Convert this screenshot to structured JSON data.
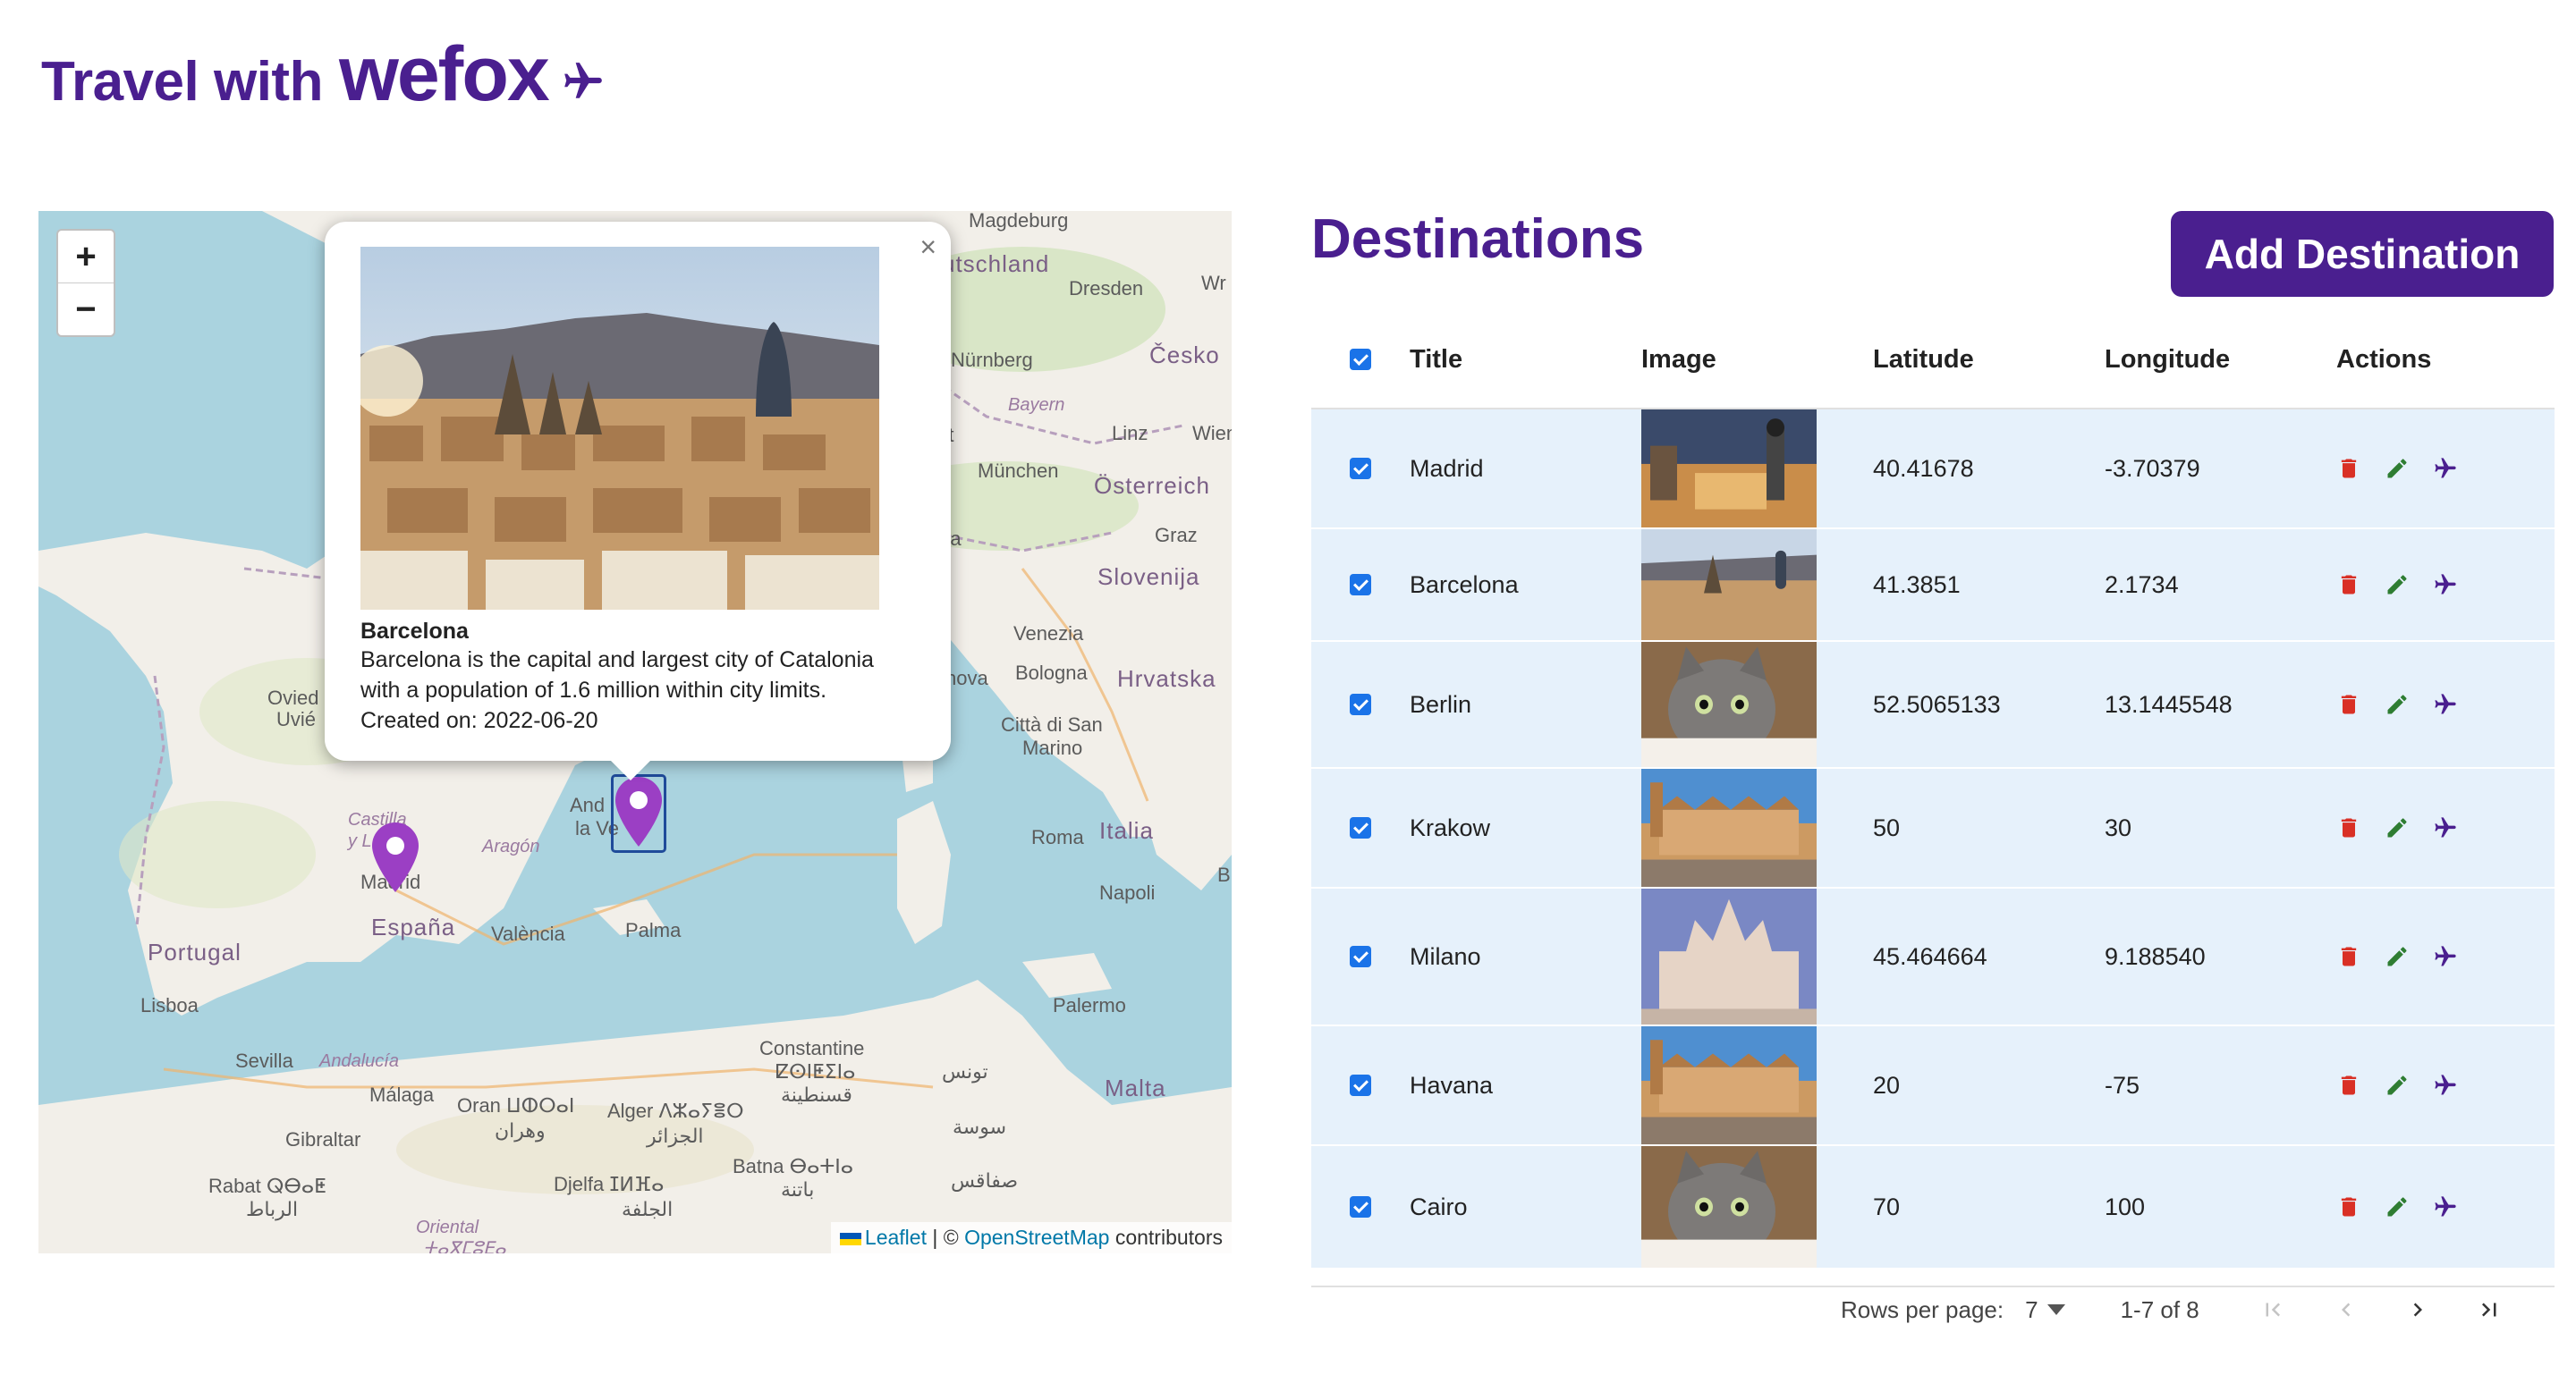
{
  "header": {
    "brand_prefix": "Travel with",
    "brand_name": "wefox",
    "brand_color": "#4a1f8f"
  },
  "map": {
    "zoom_in": "+",
    "zoom_out": "−",
    "attribution": {
      "leaflet": "Leaflet",
      "separator": "| ©",
      "osm": "OpenStreetMap",
      "suffix": "contributors"
    },
    "labels": {
      "magdeburg": "Magdeburg",
      "deutschland": "utschland",
      "dresden": "Dresden",
      "nurnberg": "Nürnberg",
      "cesko": "Česko",
      "bayern": "Bayern",
      "linz": "Linz",
      "wien": "Wien",
      "munchen": "München",
      "osterreich": "Österreich",
      "graz": "Graz",
      "slovenija": "Slovenija",
      "venezia": "Venezia",
      "bologna": "Bologna",
      "hrvatska": "Hrvatska",
      "citta_san_marino": "Città di San",
      "marino": "Marino",
      "italia": "Italia",
      "roma": "Roma",
      "napoli": "Napoli",
      "palermo": "Palermo",
      "malta": "Malta",
      "oviedo": "Ovied",
      "uviedo": "Uvié",
      "castilla": "Castilla",
      "castilla2": "y L",
      "aragon": "Aragón",
      "andorra": "And",
      "andorra2": "la Ve",
      "madrid": "Madrid",
      "espana": "España",
      "valencia": "València",
      "palma": "Palma",
      "portugal": "Portugal",
      "lisboa": "Lisboa",
      "sevilla": "Sevilla",
      "andalucia": "Andalucía",
      "malaga": "Málaga",
      "gibraltar": "Gibraltar",
      "oran": "Oran ⵡⵀⵔⴰⵏ",
      "oran_ar": "وهران",
      "alger": "Alger ⴷⵣⴰⵢⴻⵔ",
      "alger_ar": "الجزائر",
      "constantine": "Constantine",
      "constantine_tz": "ⵇⵙⵏⵟⵉⵏⴰ",
      "constantine_ar": "قسنطينة",
      "tunis": "تونس",
      "sousse": "سوسة",
      "sfax": "صفاقس",
      "batna": "Batna ⴱⴰⵜⵏⴰ",
      "batna_ar": "باتنة",
      "djelfa": "Djelfa ⵊⵍⴼⴰ",
      "djelfa_ar": "الجلفة",
      "rabat": "Rabat ⵕⴱⴰⵟ",
      "rabat_ar": "الرباط",
      "oriental": "Oriental",
      "oriental_tz": "ⵜⴰⴳⵎⵓⴹⴰ",
      "b_label": "B",
      "wr_label": "Wr",
      "rt_label": "rt",
      "ra_label": "ra",
      "nova_label": "nova"
    },
    "popup": {
      "title": "Barcelona",
      "description": "Barcelona is the capital and largest city of Catalonia with a population of 1.6 million within city limits.",
      "created": "Created on: 2022-06-20",
      "close": "×"
    },
    "marker_color": "#9b3fc4"
  },
  "destinations": {
    "title": "Destinations",
    "add_button": "Add Destination",
    "columns": {
      "title": "Title",
      "image": "Image",
      "latitude": "Latitude",
      "longitude": "Longitude",
      "actions": "Actions"
    },
    "rows": [
      {
        "title": "Madrid",
        "latitude": "40.41678",
        "longitude": "-3.70379",
        "image": "madrid-city"
      },
      {
        "title": "Barcelona",
        "latitude": "41.3851",
        "longitude": "2.1734",
        "image": "barcelona-city"
      },
      {
        "title": "Berlin",
        "latitude": "52.5065133",
        "longitude": "13.1445548",
        "image": "kitten"
      },
      {
        "title": "Krakow",
        "latitude": "50",
        "longitude": "30",
        "image": "krakow-cloth-hall"
      },
      {
        "title": "Milano",
        "latitude": "45.464664",
        "longitude": "9.188540",
        "image": "milan-cathedral"
      },
      {
        "title": "Havana",
        "latitude": "20",
        "longitude": "-75",
        "image": "krakow-cloth-hall"
      },
      {
        "title": "Cairo",
        "latitude": "70",
        "longitude": "100",
        "image": "kitten"
      }
    ],
    "pagination": {
      "rows_per_page_label": "Rows per page:",
      "rows_per_page": "7",
      "range": "1-7 of 8"
    },
    "colors": {
      "row_bg": "#e6f1fb",
      "delete": "#d93025",
      "edit": "#2e7d32",
      "fly": "#4a1f8f",
      "checkbox": "#1a73e8"
    }
  }
}
